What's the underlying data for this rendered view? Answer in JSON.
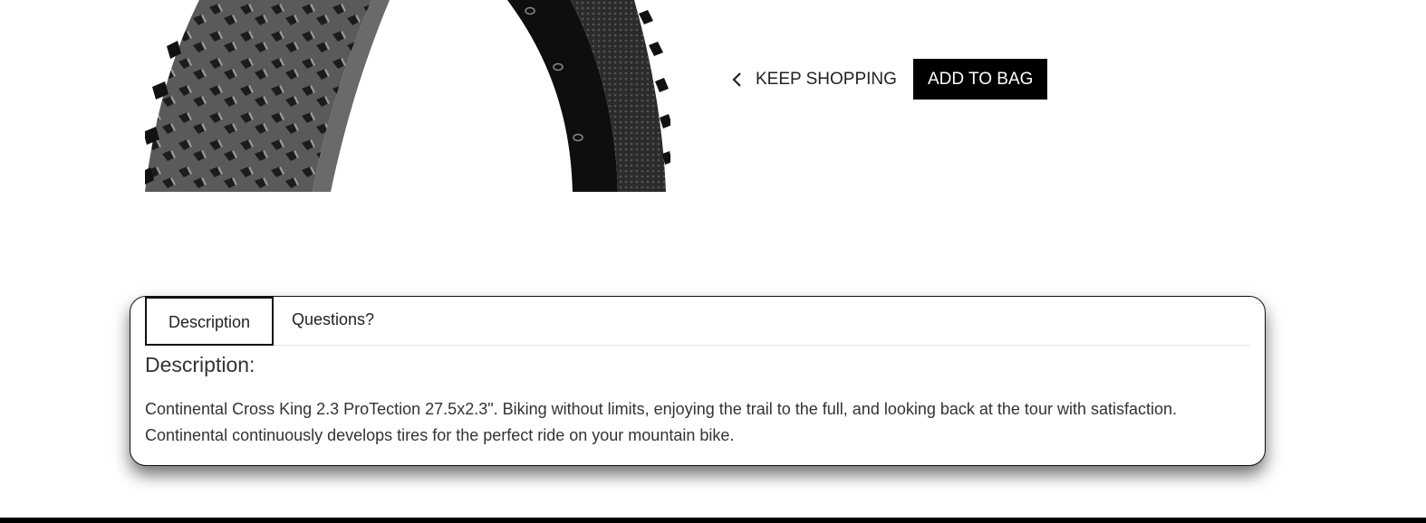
{
  "product": {
    "image_icon": "tire-image"
  },
  "actions": {
    "keep_shopping_label": "KEEP SHOPPING",
    "keep_shopping_icon": "chevron-left-icon",
    "add_to_bag_label": "ADD TO BAG"
  },
  "tabs": [
    {
      "label": "Description",
      "active": true
    },
    {
      "label": "Questions?",
      "active": false
    }
  ],
  "description": {
    "heading": "Description:",
    "text": "Continental Cross King 2.3 ProTection 27.5x2.3\". Biking without limits, enjoying the trail to the full, and looking back at the tour with satisfaction. Continental continuously develops tires for the perfect ride on your mountain bike."
  },
  "colors": {
    "button_bg": "#000000",
    "button_text": "#ffffff",
    "panel_border": "#111111"
  }
}
